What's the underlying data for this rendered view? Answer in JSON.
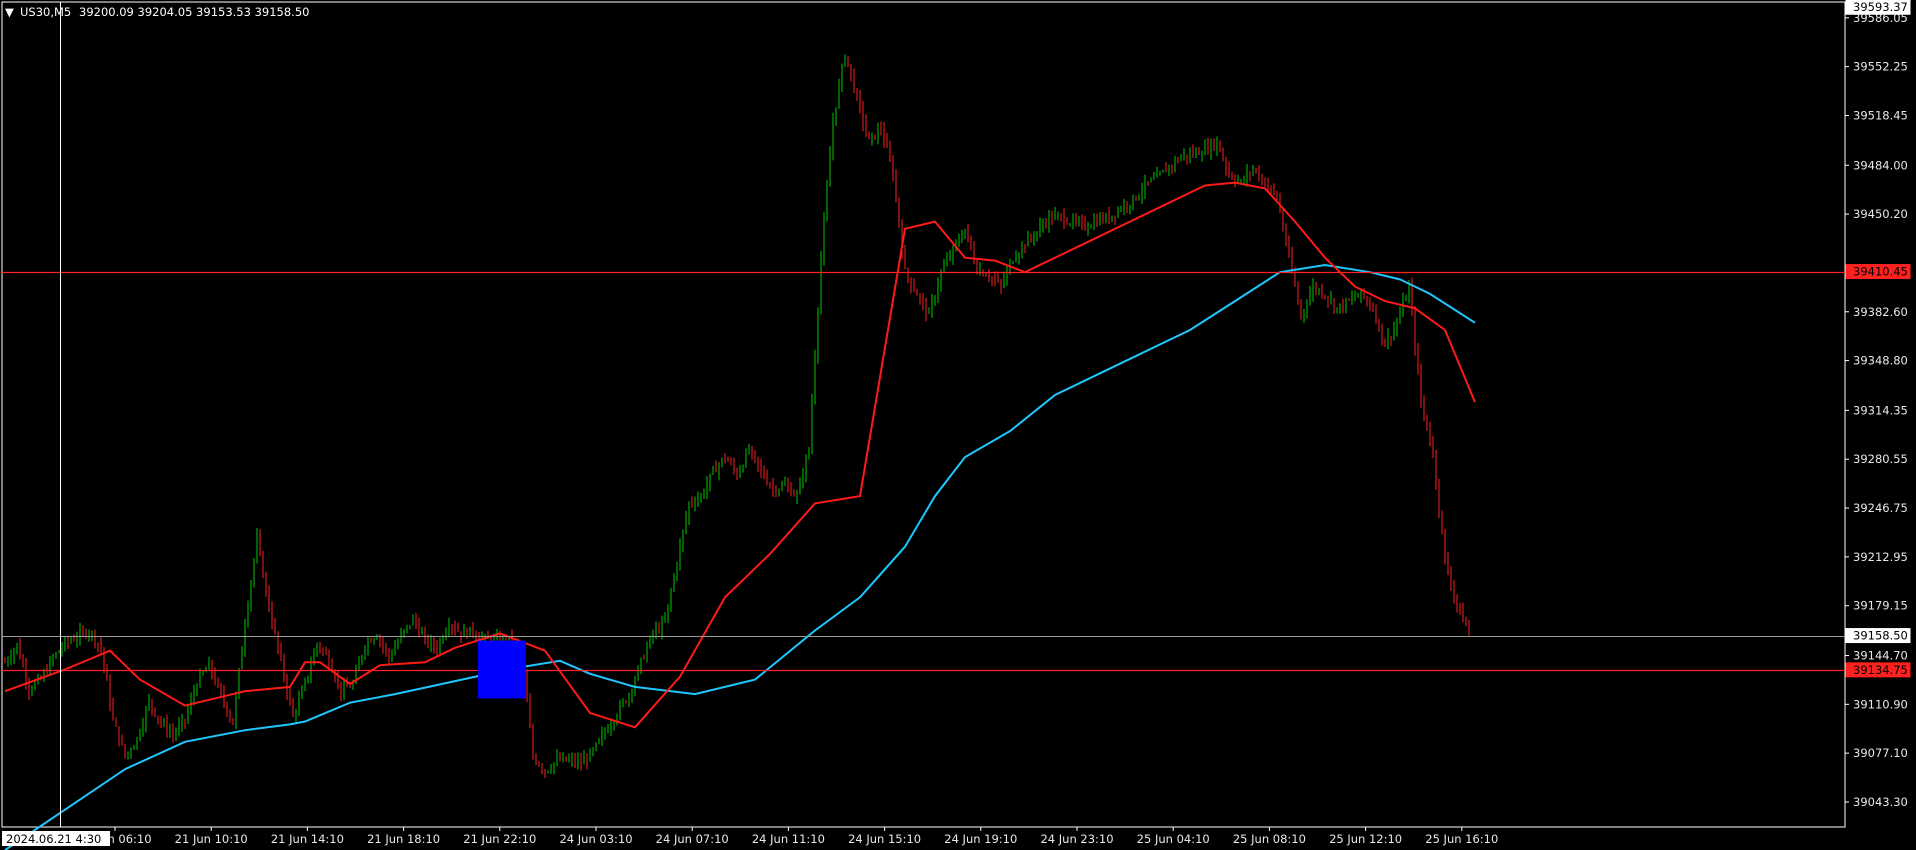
{
  "header": {
    "arrow": "▼",
    "symbol": "US30,M5",
    "ohlc": "39200.09 39204.05 39153.53 39158.50"
  },
  "colors": {
    "background": "#000000",
    "grid": "#ffffff",
    "bull": "#00c800",
    "bear": "#ff2020",
    "ma_fast": "#ff1a1a",
    "ma_slow": "#1ec8ff",
    "hline": "#ff2020",
    "marker": "#0000ff"
  },
  "crosshair_label": "2024.06.21 4:30",
  "chart_data": {
    "type": "candlestick",
    "symbol": "US30",
    "timeframe": "M5",
    "ylim": [
      39026,
      39597
    ],
    "x_ticks": [
      "21 Jun 06:10",
      "21 Jun 10:10",
      "21 Jun 14:10",
      "21 Jun 18:10",
      "21 Jun 22:10",
      "24 Jun 03:10",
      "24 Jun 07:10",
      "24 Jun 11:10",
      "24 Jun 15:10",
      "24 Jun 19:10",
      "24 Jun 23:10",
      "25 Jun 04:10",
      "25 Jun 08:10",
      "25 Jun 12:10",
      "25 Jun 16:10"
    ],
    "y_ticks": [
      "39586.05",
      "39552.25",
      "39518.45",
      "39484.00",
      "39450.20",
      "39382.60",
      "39348.80",
      "39314.35",
      "39280.55",
      "39246.75",
      "39212.95",
      "39179.15",
      "39144.70",
      "39110.90",
      "39077.10",
      "39043.30"
    ],
    "price_labels": [
      {
        "name": "top",
        "value": "39593.37",
        "kind": "top"
      },
      {
        "name": "resistance",
        "value": "39410.45",
        "kind": "hline"
      },
      {
        "name": "current",
        "value": "39158.50",
        "kind": "current"
      },
      {
        "name": "support",
        "value": "39134.75",
        "kind": "hline"
      }
    ],
    "hlines": [
      39410.45,
      39134.75
    ],
    "current_price": 39158.5,
    "price_path": [
      [
        0,
        39140
      ],
      [
        4,
        39152
      ],
      [
        8,
        39122
      ],
      [
        12,
        39128
      ],
      [
        16,
        39143
      ],
      [
        20,
        39153
      ],
      [
        24,
        39158
      ],
      [
        28,
        39162
      ],
      [
        32,
        39150
      ],
      [
        36,
        39100
      ],
      [
        40,
        39075
      ],
      [
        44,
        39087
      ],
      [
        48,
        39113
      ],
      [
        52,
        39098
      ],
      [
        56,
        39090
      ],
      [
        60,
        39100
      ],
      [
        64,
        39126
      ],
      [
        68,
        39138
      ],
      [
        72,
        39117
      ],
      [
        76,
        39098
      ],
      [
        80,
        39168
      ],
      [
        84,
        39225
      ],
      [
        88,
        39178
      ],
      [
        92,
        39140
      ],
      [
        96,
        39102
      ],
      [
        100,
        39125
      ],
      [
        104,
        39153
      ],
      [
        108,
        39142
      ],
      [
        112,
        39120
      ],
      [
        116,
        39125
      ],
      [
        120,
        39153
      ],
      [
        124,
        39160
      ],
      [
        128,
        39143
      ],
      [
        132,
        39158
      ],
      [
        136,
        39170
      ],
      [
        140,
        39155
      ],
      [
        144,
        39150
      ],
      [
        148,
        39168
      ],
      [
        152,
        39160
      ],
      [
        156,
        39162
      ],
      [
        160,
        39155
      ],
      [
        164,
        39155
      ],
      [
        168,
        39155
      ],
      [
        172,
        39148
      ],
      [
        176,
        39075
      ],
      [
        180,
        39065
      ],
      [
        184,
        39072
      ],
      [
        188,
        39072
      ],
      [
        192,
        39070
      ],
      [
        196,
        39078
      ],
      [
        200,
        39092
      ],
      [
        204,
        39105
      ],
      [
        208,
        39118
      ],
      [
        212,
        39140
      ],
      [
        216,
        39160
      ],
      [
        220,
        39168
      ],
      [
        224,
        39210
      ],
      [
        228,
        39250
      ],
      [
        232,
        39255
      ],
      [
        236,
        39272
      ],
      [
        240,
        39282
      ],
      [
        244,
        39270
      ],
      [
        248,
        39287
      ],
      [
        252,
        39272
      ],
      [
        256,
        39260
      ],
      [
        260,
        39262
      ],
      [
        264,
        39255
      ],
      [
        268,
        39288
      ],
      [
        272,
        39420
      ],
      [
        276,
        39515
      ],
      [
        280,
        39562
      ],
      [
        284,
        39530
      ],
      [
        288,
        39500
      ],
      [
        292,
        39510
      ],
      [
        296,
        39478
      ],
      [
        300,
        39410
      ],
      [
        304,
        39395
      ],
      [
        308,
        39380
      ],
      [
        312,
        39410
      ],
      [
        316,
        39425
      ],
      [
        320,
        39440
      ],
      [
        324,
        39412
      ],
      [
        328,
        39408
      ],
      [
        332,
        39400
      ],
      [
        336,
        39420
      ],
      [
        340,
        39430
      ],
      [
        344,
        39438
      ],
      [
        348,
        39448
      ],
      [
        352,
        39448
      ],
      [
        356,
        39444
      ],
      [
        360,
        39442
      ],
      [
        364,
        39446
      ],
      [
        368,
        39448
      ],
      [
        372,
        39455
      ],
      [
        376,
        39460
      ],
      [
        380,
        39470
      ],
      [
        384,
        39475
      ],
      [
        388,
        39483
      ],
      [
        392,
        39490
      ],
      [
        396,
        39492
      ],
      [
        400,
        39495
      ],
      [
        404,
        39500
      ],
      [
        408,
        39478
      ],
      [
        412,
        39472
      ],
      [
        416,
        39482
      ],
      [
        420,
        39472
      ],
      [
        424,
        39462
      ],
      [
        428,
        39420
      ],
      [
        432,
        39380
      ],
      [
        436,
        39400
      ],
      [
        440,
        39395
      ],
      [
        444,
        39385
      ],
      [
        448,
        39390
      ],
      [
        452,
        39395
      ],
      [
        456,
        39385
      ],
      [
        460,
        39360
      ],
      [
        464,
        39375
      ],
      [
        468,
        39400
      ],
      [
        472,
        39320
      ],
      [
        476,
        39285
      ],
      [
        480,
        39210
      ],
      [
        484,
        39180
      ],
      [
        488,
        39160
      ]
    ],
    "ma_fast_path": [
      [
        0,
        39120
      ],
      [
        20,
        39135
      ],
      [
        35,
        39148
      ],
      [
        45,
        39128
      ],
      [
        60,
        39110
      ],
      [
        80,
        39120
      ],
      [
        95,
        39123
      ],
      [
        100,
        39140
      ],
      [
        105,
        39140
      ],
      [
        115,
        39125
      ],
      [
        125,
        39138
      ],
      [
        140,
        39140
      ],
      [
        150,
        39150
      ],
      [
        165,
        39160
      ],
      [
        180,
        39148
      ],
      [
        195,
        39105
      ],
      [
        210,
        39095
      ],
      [
        225,
        39130
      ],
      [
        240,
        39185
      ],
      [
        255,
        39215
      ],
      [
        270,
        39250
      ],
      [
        285,
        39255
      ],
      [
        300,
        39440
      ],
      [
        310,
        39445
      ],
      [
        320,
        39420
      ],
      [
        330,
        39418
      ],
      [
        340,
        39410
      ],
      [
        360,
        39430
      ],
      [
        375,
        39445
      ],
      [
        390,
        39460
      ],
      [
        400,
        39470
      ],
      [
        410,
        39472
      ],
      [
        420,
        39468
      ],
      [
        430,
        39445
      ],
      [
        440,
        39420
      ],
      [
        450,
        39400
      ],
      [
        460,
        39390
      ],
      [
        470,
        39385
      ],
      [
        480,
        39370
      ],
      [
        490,
        39320
      ]
    ],
    "ma_slow_path": [
      [
        0,
        39010
      ],
      [
        20,
        39038
      ],
      [
        40,
        39066
      ],
      [
        60,
        39085
      ],
      [
        80,
        39093
      ],
      [
        95,
        39097
      ],
      [
        100,
        39099
      ],
      [
        115,
        39112
      ],
      [
        130,
        39118
      ],
      [
        150,
        39127
      ],
      [
        170,
        39136
      ],
      [
        185,
        39141
      ],
      [
        195,
        39132
      ],
      [
        210,
        39123
      ],
      [
        230,
        39118
      ],
      [
        250,
        39128
      ],
      [
        270,
        39162
      ],
      [
        285,
        39185
      ],
      [
        300,
        39220
      ],
      [
        310,
        39255
      ],
      [
        320,
        39282
      ],
      [
        335,
        39300
      ],
      [
        350,
        39325
      ],
      [
        365,
        39340
      ],
      [
        380,
        39355
      ],
      [
        395,
        39370
      ],
      [
        410,
        39390
      ],
      [
        425,
        39410
      ],
      [
        440,
        39415
      ],
      [
        455,
        39410
      ],
      [
        465,
        39405
      ],
      [
        475,
        39395
      ],
      [
        490,
        39375
      ]
    ]
  }
}
